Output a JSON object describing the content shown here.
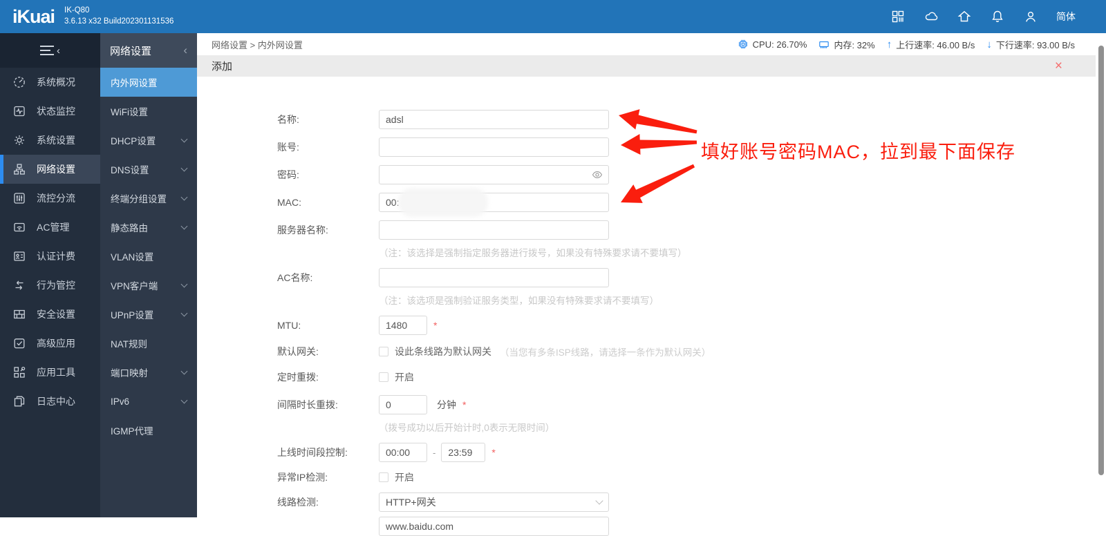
{
  "colors": {
    "topbar": "#2274b8",
    "accent": "#2d8cf0",
    "submenu_active": "#4e9ad6",
    "annotation_red": "#fa1e0e",
    "close_red": "#f56c6c"
  },
  "topbar": {
    "logo": "iKuai",
    "model": "IK-Q80",
    "build": "3.6.13 x32 Build202301131536",
    "icons": [
      "apps-icon",
      "cloud-icon",
      "home-icon",
      "bell-icon",
      "user-icon"
    ],
    "lang": "简体"
  },
  "sidebar": {
    "items": [
      {
        "label": "系统概况",
        "icon": "gauge-icon",
        "active": false
      },
      {
        "label": "状态监控",
        "icon": "monitor-icon",
        "active": false
      },
      {
        "label": "系统设置",
        "icon": "gear-icon",
        "active": false
      },
      {
        "label": "网络设置",
        "icon": "network-icon",
        "active": true
      },
      {
        "label": "流控分流",
        "icon": "sliders-icon",
        "active": false
      },
      {
        "label": "AC管理",
        "icon": "ac-icon",
        "active": false
      },
      {
        "label": "认证计费",
        "icon": "auth-icon",
        "active": false
      },
      {
        "label": "行为管控",
        "icon": "behavior-icon",
        "active": false
      },
      {
        "label": "安全设置",
        "icon": "firewall-icon",
        "active": false
      },
      {
        "label": "高级应用",
        "icon": "advanced-icon",
        "active": false
      },
      {
        "label": "应用工具",
        "icon": "tools-icon",
        "active": false
      },
      {
        "label": "日志中心",
        "icon": "logs-icon",
        "active": false
      }
    ]
  },
  "submenu": {
    "title": "网络设置",
    "items": [
      {
        "label": "内外网设置",
        "active": true,
        "chevron": false
      },
      {
        "label": "WiFi设置",
        "active": false,
        "chevron": false
      },
      {
        "label": "DHCP设置",
        "active": false,
        "chevron": true
      },
      {
        "label": "DNS设置",
        "active": false,
        "chevron": true
      },
      {
        "label": "终端分组设置",
        "active": false,
        "chevron": true
      },
      {
        "label": "静态路由",
        "active": false,
        "chevron": true
      },
      {
        "label": "VLAN设置",
        "active": false,
        "chevron": false
      },
      {
        "label": "VPN客户端",
        "active": false,
        "chevron": true
      },
      {
        "label": "UPnP设置",
        "active": false,
        "chevron": true
      },
      {
        "label": "NAT规则",
        "active": false,
        "chevron": false
      },
      {
        "label": "端口映射",
        "active": false,
        "chevron": true
      },
      {
        "label": "IPv6",
        "active": false,
        "chevron": true
      },
      {
        "label": "IGMP代理",
        "active": false,
        "chevron": false
      }
    ]
  },
  "statusbar": {
    "breadcrumb": "网络设置 > 内外网设置",
    "cpu": "CPU: 26.70%",
    "mem": "内存: 32%",
    "up_arrow": "↑",
    "up": "上行速率: 46.00 B/s",
    "down_arrow": "↓",
    "down": "下行速率: 93.00 B/s"
  },
  "panel": {
    "title": "添加",
    "close": "×"
  },
  "form": {
    "name_label": "名称:",
    "name_value": "adsl",
    "account_label": "账号:",
    "account_value": "",
    "password_label": "密码:",
    "password_value": "",
    "mac_label": "MAC:",
    "mac_value": "00:",
    "server_label": "服务器名称:",
    "server_value": "",
    "server_note": "（注：该选择是强制指定服务器进行拨号，如果没有特殊要求请不要填写）",
    "ac_label": "AC名称:",
    "ac_value": "",
    "ac_note": "（注：该选项是强制验证服务类型，如果没有特殊要求请不要填写）",
    "mtu_label": "MTU:",
    "mtu_value": "1480",
    "gateway_label": "默认网关:",
    "gateway_checkbox": "设此条线路为默认网关",
    "gateway_hint": "（当您有多条ISP线路，请选择一条作为默认网关）",
    "redial_label": "定时重拨:",
    "redial_checkbox": "开启",
    "interval_label": "间隔时长重拨:",
    "interval_value": "0",
    "interval_unit": "分钟",
    "interval_note": "（拨号成功以后开始计时,0表示无限时间）",
    "online_label": "上线时间段控制:",
    "time_from": "00:00",
    "time_sep": "-",
    "time_to": "23:59",
    "ipcheck_label": "异常IP检测:",
    "ipcheck_checkbox": "开启",
    "linecheck_label": "线路检测:",
    "linecheck_value": "HTTP+网关",
    "linecheck_host": "www.baidu.com",
    "required_mark": "*"
  },
  "annotation": {
    "text": "填好账号密码MAC，拉到最下面保存"
  }
}
